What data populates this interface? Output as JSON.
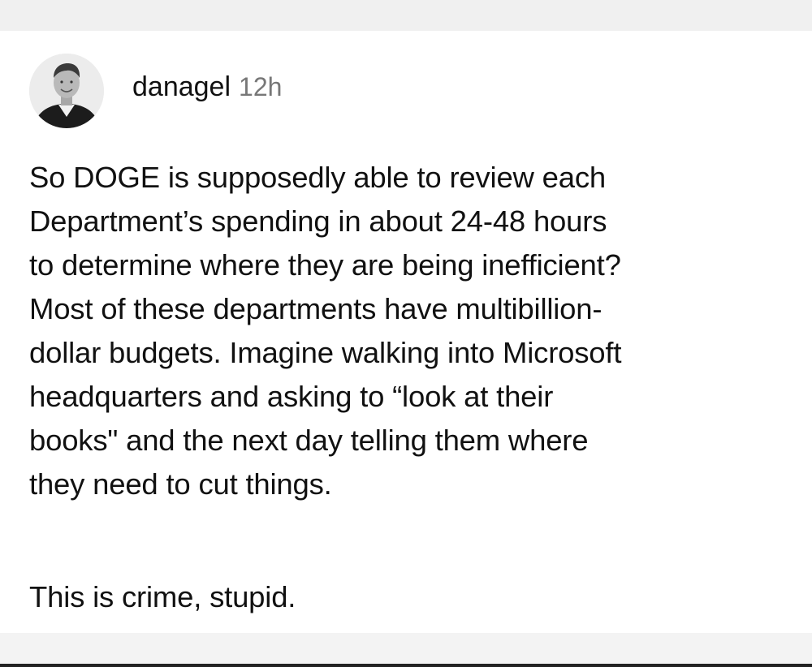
{
  "post": {
    "username": "danagel",
    "timestamp": "12h",
    "avatar_icon": "profile-photo-icon",
    "body_lines": [
      "So DOGE is supposedly able to review each",
      "Department’s spending in about 24-48 hours",
      "to determine where they are being inefficient?",
      "Most of these departments have multibillion-",
      "dollar budgets. Imagine walking into Microsoft",
      "headquarters and asking to “look at their",
      "books\" and the next day telling them where",
      "they need to cut things."
    ],
    "closing": "This is crime, stupid."
  },
  "colors": {
    "text": "#111111",
    "timestamp": "#777777",
    "background": "#ffffff"
  }
}
